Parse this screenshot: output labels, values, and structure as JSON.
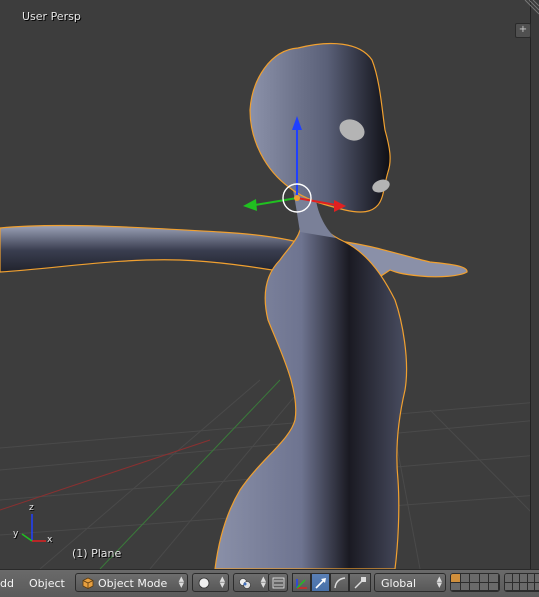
{
  "viewport": {
    "view_name": "User Persp",
    "object_name": "(1) Plane",
    "axis_labels": {
      "x": "x",
      "y": "y",
      "z": "z"
    }
  },
  "header": {
    "add_menu": "dd",
    "object_menu": "Object",
    "mode": "Object Mode",
    "pivot_icon": "circle-icon",
    "manipulator_icon": "transform-icon",
    "orientation": "Global"
  },
  "colors": {
    "selection_outline": "#f0a030",
    "x_axis": "#e02020",
    "y_axis": "#20c020",
    "z_axis": "#2040ff",
    "active_button": "#5680c0"
  }
}
